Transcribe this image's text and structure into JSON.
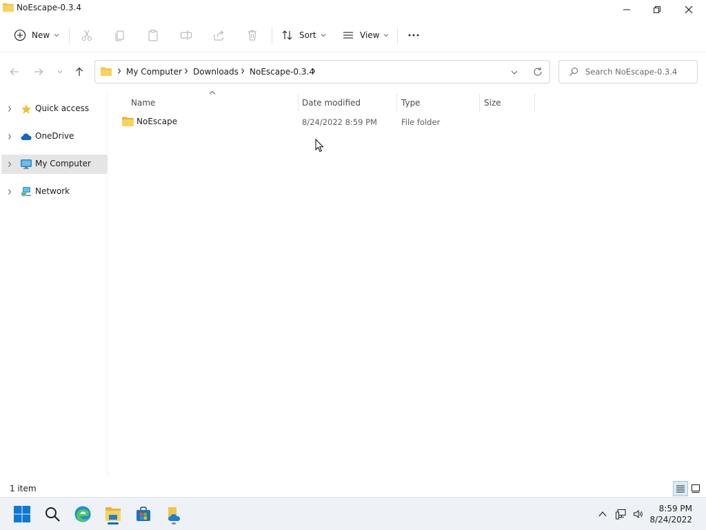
{
  "window": {
    "title": "NoEscape-0.3.4"
  },
  "toolbar": {
    "new_label": "New",
    "sort_label": "Sort",
    "view_label": "View"
  },
  "address": {
    "crumbs": [
      "My Computer",
      "Downloads",
      "NoEscape-0.3.4"
    ]
  },
  "search": {
    "placeholder": "Search NoEscape-0.3.4"
  },
  "navpane": {
    "items": [
      {
        "label": "Quick access",
        "icon": "star-icon"
      },
      {
        "label": "OneDrive",
        "icon": "cloud-icon"
      },
      {
        "label": "My Computer",
        "icon": "computer-icon"
      },
      {
        "label": "Network",
        "icon": "network-icon"
      }
    ],
    "selected": "My Computer"
  },
  "columns": {
    "name": "Name",
    "date": "Date modified",
    "type": "Type",
    "size": "Size"
  },
  "files": [
    {
      "name": "NoEscape",
      "date": "8/24/2022 8:59 PM",
      "type": "File folder",
      "size": ""
    }
  ],
  "status": {
    "count": "1 item"
  },
  "taskbar": {
    "time": "8:59 PM",
    "date": "8/24/2022"
  },
  "colors": {
    "accent": "#0067c0",
    "folder": "#f3c44a",
    "selected_bg": "#e5e5e5"
  }
}
